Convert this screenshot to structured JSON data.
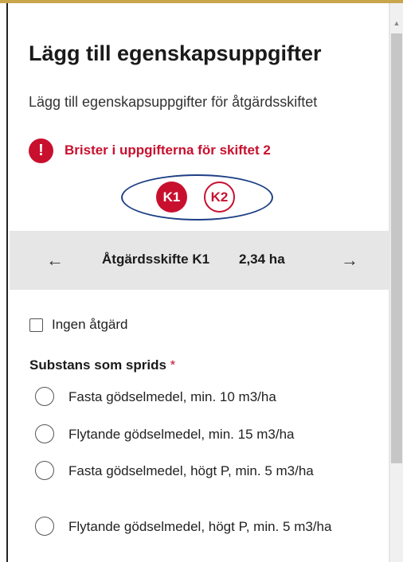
{
  "header": {
    "title": "Lägg till egenskapsuppgifter",
    "subtitle": "Lägg till egenskapsuppgifter för åtgärdsskiftet"
  },
  "error": {
    "icon": "!",
    "message": "Brister i uppgifterna för skiftet 2"
  },
  "fields": [
    {
      "label": "K1",
      "state": "selected"
    },
    {
      "label": "K2",
      "state": "unselected"
    }
  ],
  "navigator": {
    "prev_icon": "←",
    "field_name": "Åtgärdsskifte K1",
    "area": "2,34 ha",
    "next_icon": "→"
  },
  "no_action": {
    "label": "Ingen åtgärd",
    "checked": false
  },
  "substance": {
    "label": "Substans som sprids",
    "required_marker": "*",
    "options": [
      {
        "label": "Fasta gödselmedel, min. 10 m3/ha",
        "selected": false
      },
      {
        "label": "Flytande gödselmedel, min. 15 m3/ha",
        "selected": false
      },
      {
        "label": "Fasta gödselmedel, högt P, min. 5 m3/ha",
        "selected": false
      },
      {
        "label": "Flytande gödselmedel, högt P, min. 5 m3/ha",
        "selected": false
      }
    ]
  },
  "colors": {
    "error_red": "#c8102e",
    "oval_blue": "#1e3f86",
    "nav_band": "#e6e6e6",
    "top_accent": "#c9a64b"
  }
}
